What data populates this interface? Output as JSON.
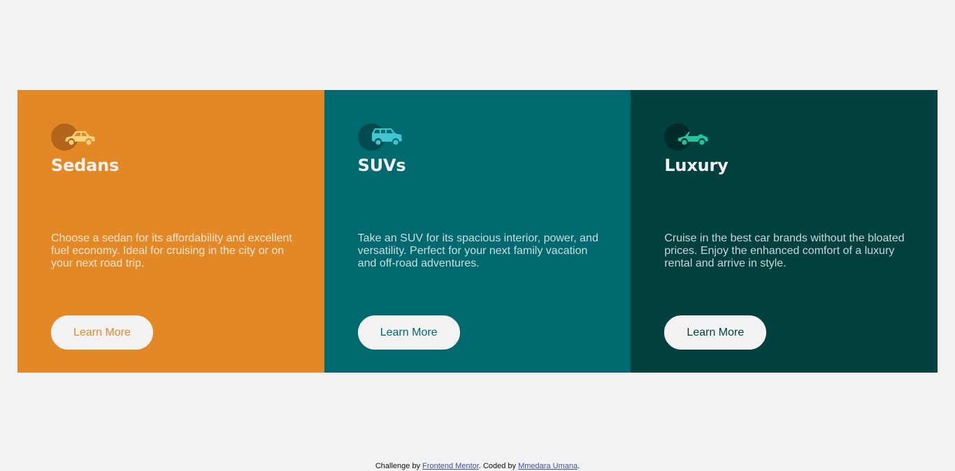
{
  "cards": [
    {
      "title": "Sedans",
      "description": "Choose a sedan for its affordability and excellent fuel economy. Ideal for cruising in the city or on your next road trip.",
      "button_label": "Learn More",
      "icon": "sedan-car-icon",
      "colors": {
        "background": "#e38826",
        "circle": "#b2651a",
        "icon": "#ffd47f",
        "button_text": "#e38826"
      }
    },
    {
      "title": "SUVs",
      "description": "Take an SUV for its spacious interior, power, and versatility. Perfect for your next family vacation and off-road adventures.",
      "button_label": "Learn More",
      "icon": "suv-car-icon",
      "colors": {
        "background": "#006970",
        "circle": "#004a50",
        "icon": "#3fc6cf",
        "button_text": "#006970"
      }
    },
    {
      "title": "Luxury",
      "description": "Cruise in the best car brands without the bloated prices. Enjoy the enhanced comfort of a luxury rental and arrive in style.",
      "button_label": "Learn More",
      "icon": "convertible-car-icon",
      "colors": {
        "background": "#004140",
        "circle": "#002b2a",
        "icon": "#22c49b",
        "button_text": "#004140"
      }
    }
  ],
  "footer": {
    "prefix": "Challenge by ",
    "link1": "Frontend Mentor",
    "middle": ". Coded by ",
    "link2": "Mmedara Umana",
    "suffix": "."
  }
}
